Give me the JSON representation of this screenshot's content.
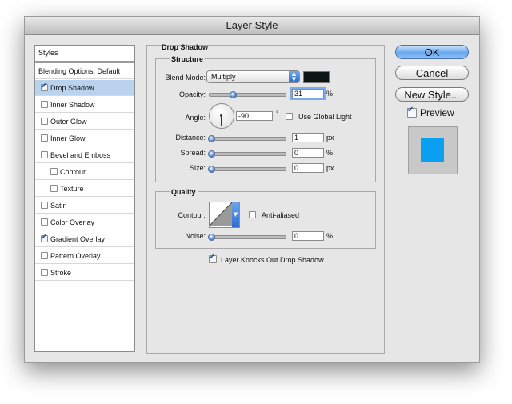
{
  "window": {
    "title": "Layer Style"
  },
  "sidebar": {
    "header": "Styles",
    "items": [
      {
        "label": "Blending Options: Default",
        "checkbox": false,
        "checked": false,
        "selected": false,
        "indent": 0
      },
      {
        "label": "Drop Shadow",
        "checkbox": true,
        "checked": true,
        "selected": true,
        "indent": 0
      },
      {
        "label": "Inner Shadow",
        "checkbox": true,
        "checked": false,
        "selected": false,
        "indent": 0
      },
      {
        "label": "Outer Glow",
        "checkbox": true,
        "checked": false,
        "selected": false,
        "indent": 0
      },
      {
        "label": "Inner Glow",
        "checkbox": true,
        "checked": false,
        "selected": false,
        "indent": 0
      },
      {
        "label": "Bevel and Emboss",
        "checkbox": true,
        "checked": false,
        "selected": false,
        "indent": 0
      },
      {
        "label": "Contour",
        "checkbox": true,
        "checked": false,
        "selected": false,
        "indent": 1
      },
      {
        "label": "Texture",
        "checkbox": true,
        "checked": false,
        "selected": false,
        "indent": 1
      },
      {
        "label": "Satin",
        "checkbox": true,
        "checked": false,
        "selected": false,
        "indent": 0
      },
      {
        "label": "Color Overlay",
        "checkbox": true,
        "checked": false,
        "selected": false,
        "indent": 0
      },
      {
        "label": "Gradient Overlay",
        "checkbox": true,
        "checked": true,
        "selected": false,
        "indent": 0
      },
      {
        "label": "Pattern Overlay",
        "checkbox": true,
        "checked": false,
        "selected": false,
        "indent": 0
      },
      {
        "label": "Stroke",
        "checkbox": true,
        "checked": false,
        "selected": false,
        "indent": 0
      }
    ]
  },
  "drop_shadow": {
    "title": "Drop Shadow",
    "structure": {
      "title": "Structure",
      "blend_mode_label": "Blend Mode:",
      "blend_mode_value": "Multiply",
      "shadow_color": "#0c1414",
      "opacity_label": "Opacity:",
      "opacity_value": "31",
      "opacity_fraction": 0.31,
      "angle_label": "Angle:",
      "angle_value": "-90",
      "degree_symbol": "°",
      "use_global_light_label": "Use Global Light",
      "use_global_light_checked": false,
      "distance_label": "Distance:",
      "distance_value": "1",
      "spread_label": "Spread:",
      "spread_value": "0",
      "size_label": "Size:",
      "size_value": "0",
      "unit_px": "px",
      "unit_percent": "%"
    },
    "quality": {
      "title": "Quality",
      "contour_label": "Contour:",
      "anti_aliased_label": "Anti-aliased",
      "anti_aliased_checked": false,
      "noise_label": "Noise:",
      "noise_value": "0"
    },
    "layer_knocks_out_label": "Layer Knocks Out Drop Shadow",
    "layer_knocks_out_checked": true
  },
  "buttons": {
    "ok": "OK",
    "cancel": "Cancel",
    "new_style": "New Style...",
    "preview_label": "Preview",
    "preview_checked": true
  },
  "colors": {
    "accent": "#3b7fd9",
    "selection": "#b9d3ef",
    "preview_swatch": "#0a9ff0",
    "preview_bg": "#c8c8c8"
  }
}
